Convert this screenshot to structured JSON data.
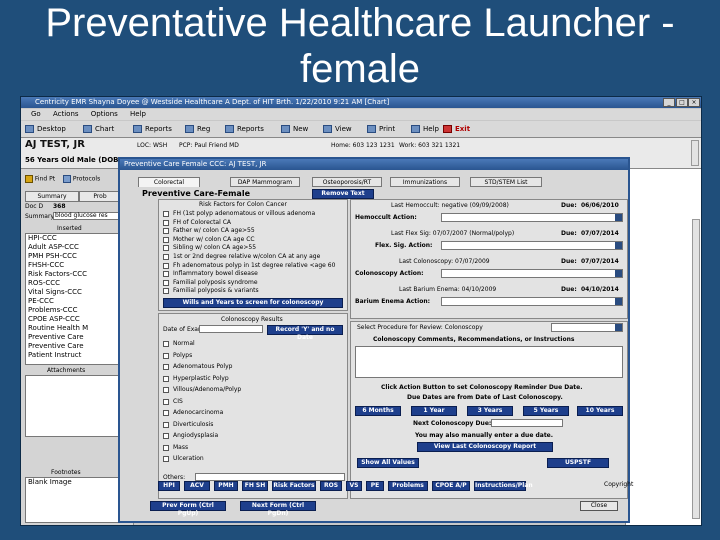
{
  "slide": {
    "title_line1": "Preventative Healthcare Launcher -",
    "title_line2": "female"
  },
  "app": {
    "title": "Centricity EMR  Shayna Doyee @ Westside Healthcare  A Dept. of HIT Brth.  1/22/2010 9:21 AM  [Chart]",
    "menu": [
      "Go",
      "Actions",
      "Options",
      "Help"
    ],
    "toolbar": [
      "Desktop",
      "Chart",
      "Reports",
      "Reg",
      "Reports",
      "New",
      "View",
      "Print",
      "Help",
      "Exit"
    ],
    "patient": {
      "name": "AJ TEST, JR",
      "loc": "LOC: WSH",
      "pcp": "PCP: Paul Friend MD",
      "home": "Home: 603 123 1231",
      "work": "Work: 603 321 1321",
      "age": "56 Years Old Male (DOB:"
    },
    "left_tools": [
      "Find Pt",
      "Protocols"
    ],
    "left_tabs": [
      "Summary",
      "Prob"
    ],
    "doc_label": "Doc D",
    "doc_value": "368",
    "summary_label": "Summary",
    "summary_value": "blood glucose res",
    "inserted_label": "Inserted",
    "inserted_items": [
      "HPI-CCC",
      "Adult ASP-CCC",
      "PMH PSH-CCC",
      "FHSH-CCC",
      "Risk Factors-CCC",
      "ROS-CCC",
      "Vital Signs-CCC",
      "PE-CCC",
      "Problems-CCC",
      "CPOE ASP-CCC",
      "Routine Health M",
      "Preventive Care",
      "Preventive Care",
      "Patient Instruct"
    ],
    "attachments_label": "Attachments",
    "footer_label": "Footnotes",
    "footer_value": "Blank Image"
  },
  "dialog": {
    "title": "Preventive Care Female CCC: AJ TEST, JR",
    "tabs": [
      "Colorectal",
      "DAP Mammogram",
      "Osteoporosis/RT",
      "Immunizations",
      "STD/STEM List"
    ],
    "heading": "Preventive Care-Female",
    "remove_text": "Remove Text",
    "risk_title": "Risk Factors for Colon Cancer",
    "risk_items": [
      "FH (1st polyp adenomatous or villous adenoma",
      "FH of Colorectal CA",
      "Father w/ colon CA age>55",
      "Mother w/ colon CA age CC",
      "Sibling w/ colon CA age>55",
      "1st or 2nd degree relative w/colon CA at any age",
      "Fh adenomatous polyp in 1st degree relative <age 60",
      "Inflammatory bowel disease",
      "Familial polyposis syndrome",
      "Familial polyposis & variants"
    ],
    "risk_button": "Wills and Years to screen for colonoscopy",
    "last_test_label": "Last Hemoccult: negative (09/09/2008)",
    "due_label": "Due:",
    "due_dates": [
      "06/06/2010",
      "07/07/2014",
      "07/07/2014",
      "04/10/2014"
    ],
    "recommend_label": "Hemoccult Action:",
    "flex_sig_last": "Last Flex Sig: 07/07/2007 (Normal/polyp)",
    "flex_sig_action": "Flex. Sig. Action:",
    "last_colon": "Last Colonoscopy: 07/07/2009",
    "colon_action": "Colonoscopy Action:",
    "last_barium": "Last Barium Enema: 04/10/2009",
    "barium_action": "Barium Enema Action:",
    "col_results_title": "Colonoscopy Results",
    "date_exam_label": "Date of Exam",
    "record_btn": "Record 'Y' and no Date",
    "result_items": [
      "Normal",
      "Polyps",
      "Adenomatous Polyp",
      "Hyperplastic Polyp",
      "Villous/Adenoma/Polyp",
      "CIS",
      "Adenocarcinoma",
      "Diverticulosis",
      "Angiodysplasia",
      "Mass",
      "Ulceration"
    ],
    "others_label": "Others:",
    "select_proc_label": "Select Procedure for Review: Colonoscopy",
    "comments_title": "Colonoscopy Comments, Recommendations, or Instructions",
    "action_hint": "Click Action Button to set Colonoscopy Reminder Due Date.",
    "due_from": "Due Dates are from Date of Last Colonoscopy.",
    "interval_buttons": [
      "6 Months",
      "1 Year",
      "3 Years",
      "5 Years",
      "10 Years"
    ],
    "next_colon_label": "Next Colonoscopy Due:",
    "manual_hint": "You may also manually enter a due date.",
    "view_last_btn": "View Last Colonoscopy Report",
    "show_all_btn": "Show All Values",
    "uspstf_btn": "USPSTF",
    "bottom_buttons": [
      "HPI",
      "ACV",
      "PMH",
      "FH SH",
      "Risk Factors",
      "ROS",
      "VS",
      "PE",
      "Problems",
      "CPOE A/P",
      "Instructions/Plan"
    ],
    "copyright": "Copyright",
    "prev_form": "Prev Form (Ctrl PgUp)",
    "next_form": "Next Form (Ctrl PgDn)",
    "close": "Close"
  },
  "colors": {
    "background": "#1f4e7a",
    "button": "#1e3f8c",
    "titlebar": "#2a5590"
  }
}
